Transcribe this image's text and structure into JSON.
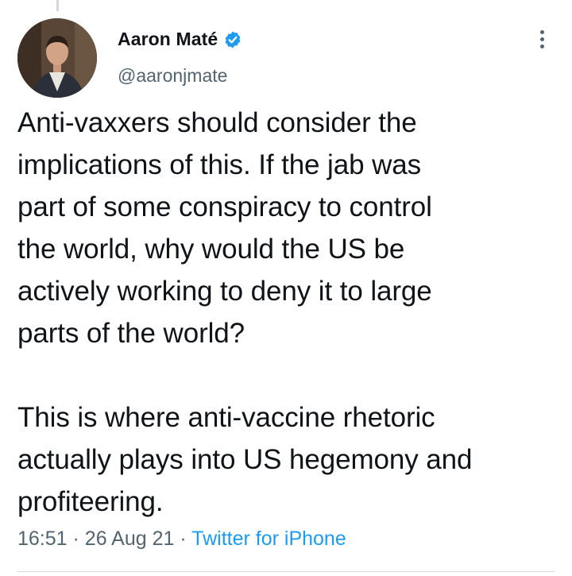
{
  "tweet": {
    "author": {
      "display_name": "Aaron Maté",
      "handle": "@aaronjmate",
      "avatar_icon": "profile-photo",
      "verified_icon": "verified-badge-icon"
    },
    "text": "Anti-vaxxers should consider the\nimplications of this. If the jab was\npart of some conspiracy to control\nthe world, why would the US be\nactively working to deny it to large\nparts of the world?\n\nThis is where anti-vaccine rhetoric\nactually plays into US hegemony and\nprofiteering.",
    "time": "16:51",
    "separator": "·",
    "date": "26 Aug 21",
    "source": "Twitter for iPhone"
  },
  "colors": {
    "text": "#0f1419",
    "secondary": "#536471",
    "accent": "#1d9bf0",
    "divider": "#cfd9de"
  },
  "icons": {
    "more": "more-vertical-icon"
  }
}
